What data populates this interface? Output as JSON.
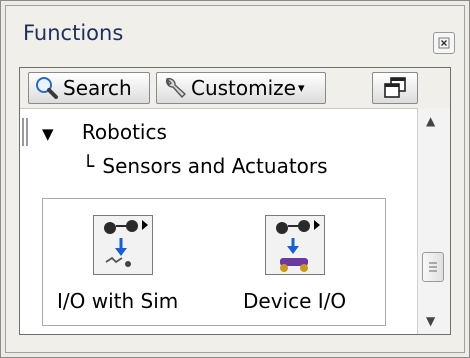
{
  "palette": {
    "title": "Functions",
    "close_icon": "close-icon"
  },
  "toolbar": {
    "search_label": "Search",
    "customize_label": "Customize",
    "customize_arrow": "▾",
    "search_icon": "search-icon",
    "customize_icon": "wrench-icon",
    "window_icon": "restore-window-icon"
  },
  "tree": {
    "category_arrow": "▼",
    "category_label": "Robotics",
    "subcategory_connector": "└",
    "subcategory_label": "Sensors and Actuators"
  },
  "items": [
    {
      "label": "I/O with Sim",
      "icon": "io-with-sim-icon"
    },
    {
      "label": "Device I/O",
      "icon": "device-io-icon"
    }
  ],
  "scrollbar": {
    "up_arrow": "▲",
    "down_arrow": "▼"
  }
}
